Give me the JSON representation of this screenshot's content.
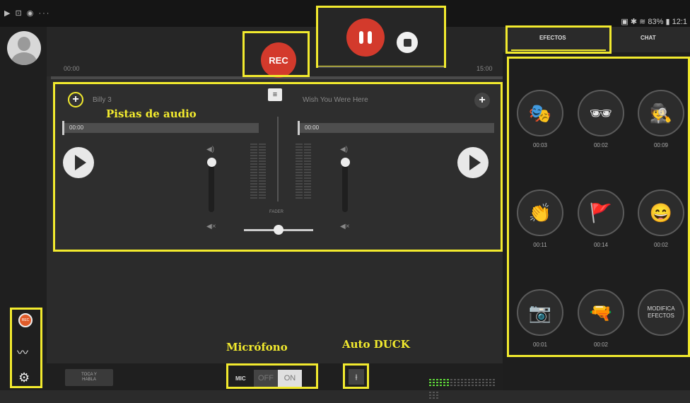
{
  "status": {
    "left_icons": "▶ ⊡ ◉ ···",
    "right_text": "▣ ✱ ≋ 83% ▮ 12:1"
  },
  "timeline": {
    "start_time": "00:00",
    "end_time": "15:00",
    "rec_label": "REC"
  },
  "tracks": [
    {
      "title": "Billy 3",
      "time": "00:00"
    },
    {
      "title": "Wish You Were Here",
      "time": "00:00"
    }
  ],
  "fader_label": "FADER",
  "annotations": {
    "pistas": "Pistas de audio",
    "microfono": "Micrófono",
    "auto_duck": "Auto DUCK"
  },
  "bottom": {
    "toca_line1": "TOCA Y",
    "toca_line2": "HABLA",
    "mic_label": "MIC",
    "off_label": "OFF",
    "on_label": "ON"
  },
  "sidebar": {
    "rec_mini": "REC"
  },
  "right_panel": {
    "tabs": [
      {
        "label": "EFECTOS",
        "active": true
      },
      {
        "label": "CHAT",
        "active": false
      }
    ],
    "effects": [
      {
        "icon": "theater-masks-icon",
        "glyph": "🎭",
        "time": "00:03"
      },
      {
        "icon": "sunglasses-icon",
        "glyph": "🕶",
        "time": "00:02"
      },
      {
        "icon": "spy-icon",
        "glyph": "🕵",
        "time": "00:09"
      },
      {
        "icon": "applause-icon",
        "glyph": "👏",
        "time": "00:11"
      },
      {
        "icon": "flag-cheer-icon",
        "glyph": "🚩",
        "time": "00:14"
      },
      {
        "icon": "laugh-icon",
        "glyph": "😄",
        "time": "00:02"
      },
      {
        "icon": "camera-icon",
        "glyph": "📷",
        "time": "00:01"
      },
      {
        "icon": "gun-icon",
        "glyph": "🔫",
        "time": "00:02"
      }
    ],
    "modify_line1": "MODIFICA",
    "modify_line2": "EFECTOS"
  },
  "colors": {
    "accent_yellow": "#f2ea2e",
    "rec_red": "#d33a2c",
    "meter_green": "#5fd93a"
  }
}
